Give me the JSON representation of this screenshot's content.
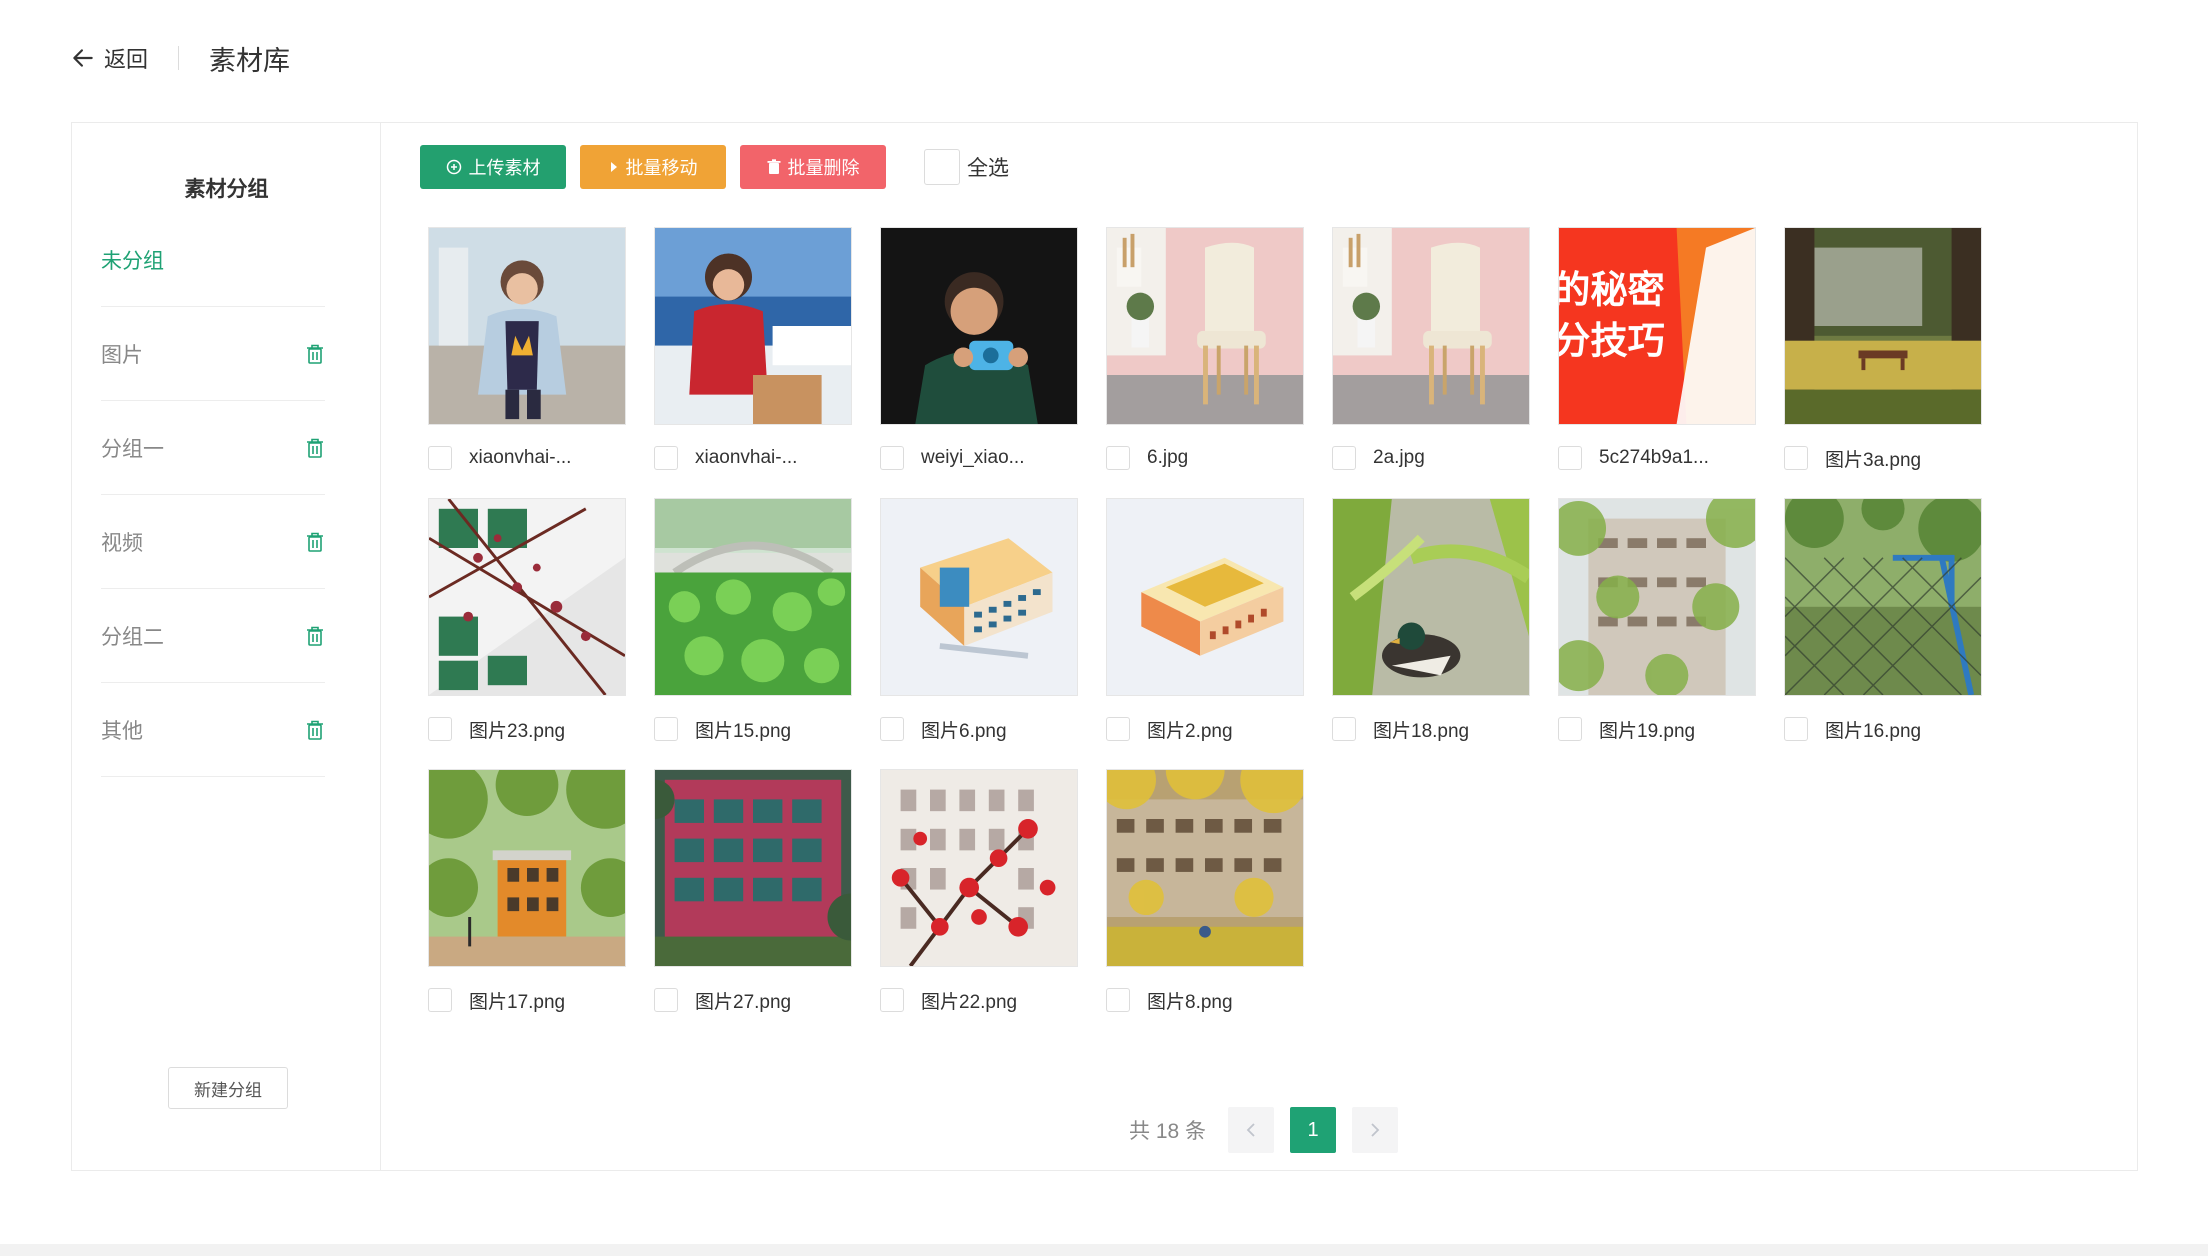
{
  "header": {
    "back_label": "返回",
    "title": "素材库"
  },
  "sidebar": {
    "title": "素材分组",
    "groups": [
      {
        "label": "未分组",
        "active": true,
        "deletable": false
      },
      {
        "label": "图片",
        "active": false,
        "deletable": true
      },
      {
        "label": "分组一",
        "active": false,
        "deletable": true
      },
      {
        "label": "视频",
        "active": false,
        "deletable": true
      },
      {
        "label": "分组二",
        "active": false,
        "deletable": true
      },
      {
        "label": "其他",
        "active": false,
        "deletable": true
      }
    ],
    "new_group_label": "新建分组"
  },
  "toolbar": {
    "upload_label": "上传素材",
    "move_label": "批量移动",
    "delete_label": "批量删除",
    "select_all_label": "全选"
  },
  "materials": [
    {
      "name": "xiaonvhai-...",
      "thumb": "boy-jacket"
    },
    {
      "name": "xiaonvhai-...",
      "thumb": "girl-red"
    },
    {
      "name": "weiyi_xiao...",
      "thumb": "boy-camera"
    },
    {
      "name": "6.jpg",
      "thumb": "chair"
    },
    {
      "name": "2a.jpg",
      "thumb": "chair"
    },
    {
      "name": "5c274b9a1...",
      "thumb": "red-banner"
    },
    {
      "name": "图片3a.png",
      "thumb": "park-bench"
    },
    {
      "name": "图片23.png",
      "thumb": "blossom-building"
    },
    {
      "name": "图片15.png",
      "thumb": "lotus-bridge"
    },
    {
      "name": "图片6.png",
      "thumb": "iso-building-1"
    },
    {
      "name": "图片2.png",
      "thumb": "iso-building-2"
    },
    {
      "name": "图片18.png",
      "thumb": "duck-leaves"
    },
    {
      "name": "图片19.png",
      "thumb": "tree-building"
    },
    {
      "name": "图片16.png",
      "thumb": "fence-court"
    },
    {
      "name": "图片17.png",
      "thumb": "orange-house"
    },
    {
      "name": "图片27.png",
      "thumb": "red-building"
    },
    {
      "name": "图片22.png",
      "thumb": "red-flowers"
    },
    {
      "name": "图片8.png",
      "thumb": "autumn-building"
    }
  ],
  "banner_text": {
    "line1": "的秘密",
    "line2": "分技巧"
  },
  "pagination": {
    "total_label": "共 18 条",
    "current_page": "1",
    "prev": "‹",
    "next": "›"
  },
  "colors": {
    "accent": "#1fa274",
    "upload": "#23a06f",
    "move": "#f0a336",
    "delete": "#f2646a"
  }
}
